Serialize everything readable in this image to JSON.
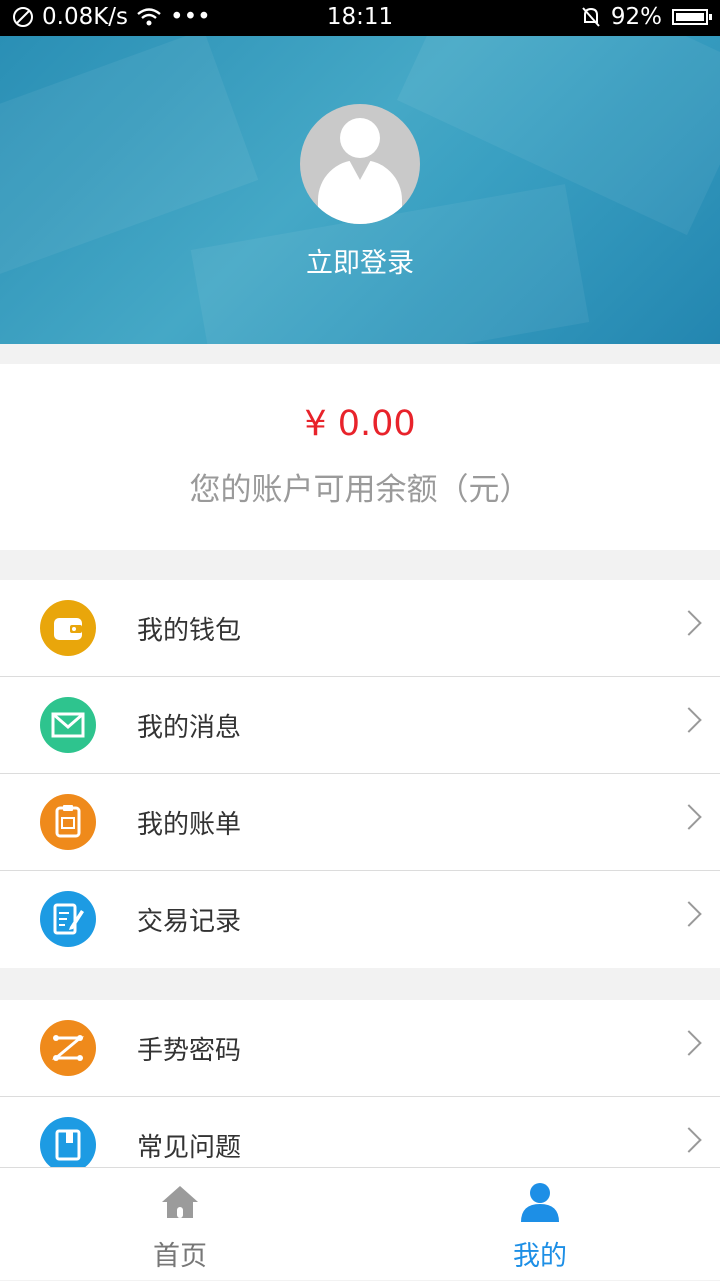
{
  "status_bar": {
    "speed": "0.08K/s",
    "dots": "•••",
    "time": "18:11",
    "battery": "92%"
  },
  "profile": {
    "login_label": "立即登录"
  },
  "balance": {
    "amount": "¥ 0.00",
    "description": "您的账户可用余额（元）"
  },
  "menu_group_1": [
    {
      "label": "我的钱包",
      "icon": "wallet-icon",
      "color": "#e9a60b"
    },
    {
      "label": "我的消息",
      "icon": "mail-icon",
      "color": "#2ec48e"
    },
    {
      "label": "我的账单",
      "icon": "clipboard-icon",
      "color": "#ef8a1b"
    },
    {
      "label": "交易记录",
      "icon": "edit-record-icon",
      "color": "#1d9be3"
    }
  ],
  "menu_group_2": [
    {
      "label": "手势密码",
      "icon": "gesture-icon",
      "color": "#ef8a1b"
    },
    {
      "label": "常见问题",
      "icon": "book-icon",
      "color": "#1d9be3"
    }
  ],
  "tabbar": {
    "home_label": "首页",
    "mine_label": "我的",
    "inactive_color": "#9b9b9b",
    "active_color": "#1d8fe6"
  }
}
